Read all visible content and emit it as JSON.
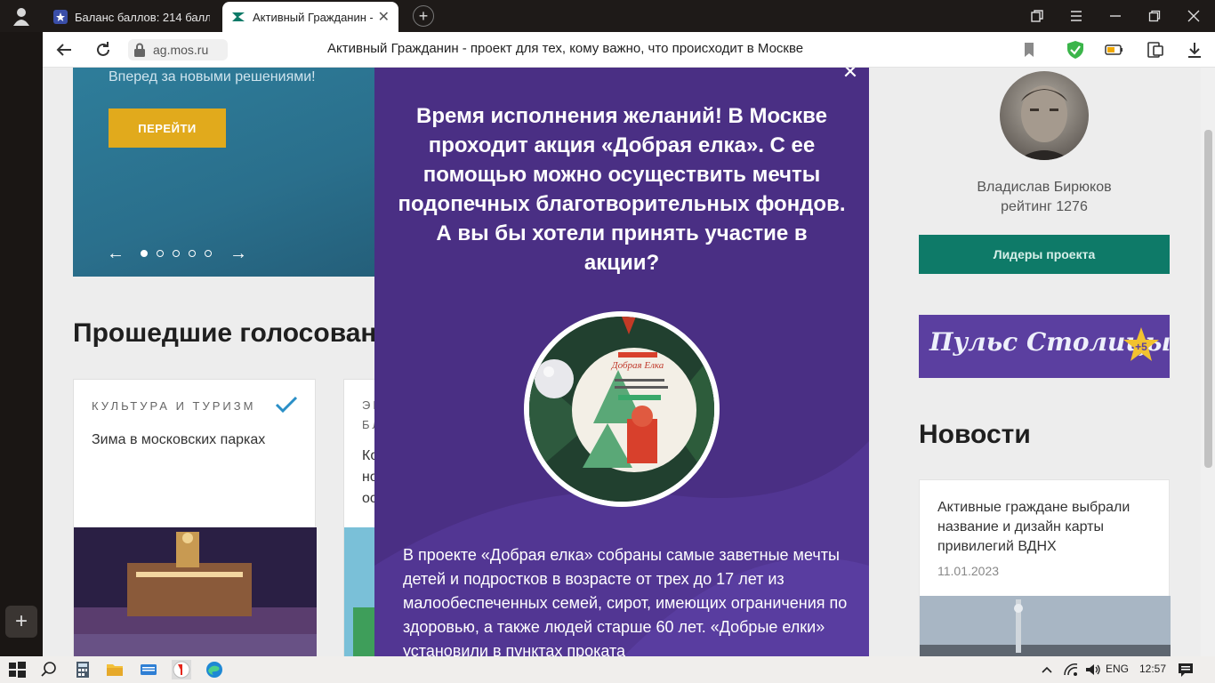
{
  "browser": {
    "tabs": [
      {
        "title": "Баланс баллов: 214 балл",
        "active": false
      },
      {
        "title": "Активный Гражданин - пр",
        "active": true
      }
    ],
    "url": "ag.mos.ru",
    "page_heading": "Активный Гражданин - проект для тех, кому важно, что происходит в Москве"
  },
  "banner": {
    "text": "Вперед за новыми решениями!",
    "button": "ПЕРЕЙТИ"
  },
  "past_votes": {
    "title": "Прошедшие голосован",
    "cards": [
      {
        "category": "КУЛЬТУРА И ТУРИЗМ",
        "title": "Зима в московских парках"
      },
      {
        "category": "ЭК\nБЛ",
        "title": "Ко\nно\nос"
      }
    ]
  },
  "user": {
    "name": "Владислав Бирюков",
    "rating": "рейтинг 1276"
  },
  "leaders_button": "Лидеры проекта",
  "pulse": {
    "text": "Пульс Столицы",
    "badge": "+5"
  },
  "news": {
    "title": "Новости",
    "item": {
      "text": "Активные граждане выбрали название и дизайн карты привилегий ВДНХ",
      "date": "11.01.2023"
    }
  },
  "modal": {
    "question": "Время исполнения желаний! В Москве проходит акция «Добрая елка». С ее помощью можно осуществить мечты подопечных благотворительных фондов. А вы бы хотели принять участие в акции?",
    "body": "В проекте «Добрая елка» собраны самые заветные мечты детей и подростков в возрасте от трех до 17 лет из малообеспеченных семей, сирот, имеющих ограничения по здоровью, а также людей старше 60 лет. «Добрые елки» установили в пунктах проката",
    "photo_caption": "Добрая Елка"
  },
  "taskbar": {
    "lang": "ENG",
    "time": "12:57"
  },
  "colors": {
    "modal_bg": "#4a2f84",
    "leaders_btn": "#0e7a68",
    "banner_btn": "#e1aa1c"
  }
}
